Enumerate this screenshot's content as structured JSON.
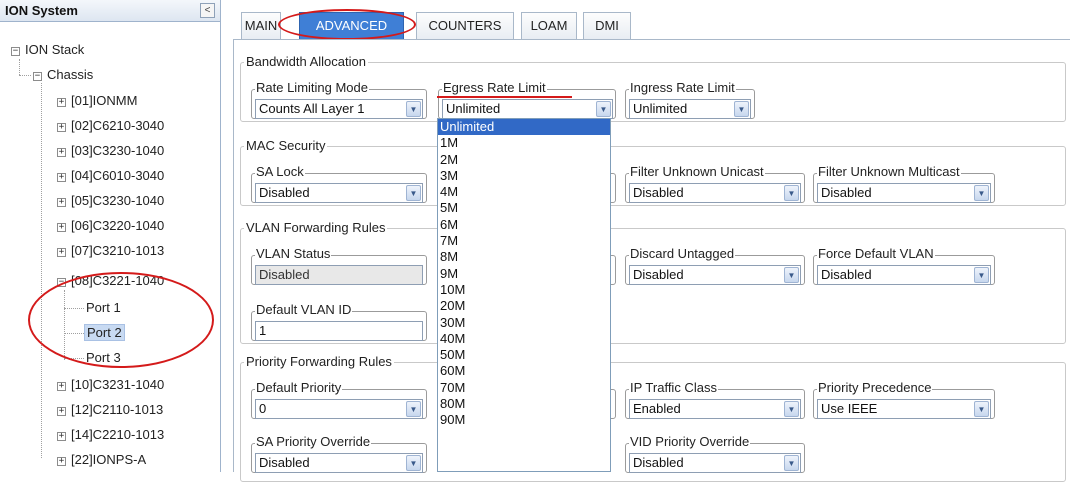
{
  "tree": {
    "title": "ION System",
    "collapse_glyph": "<",
    "root": "ION Stack",
    "chassis": "Chassis",
    "modules": [
      "[01]IONMM",
      "[02]C6210-3040",
      "[03]C3230-1040",
      "[04]C6010-3040",
      "[05]C3230-1040",
      "[06]C3220-1040",
      "[07]C3210-1013",
      "[08]C3221-1040"
    ],
    "ports": [
      "Port 1",
      "Port 2",
      "Port 3"
    ],
    "modules_after": [
      "[10]C3231-1040",
      "[12]C2110-1013",
      "[14]C2210-1013",
      "[22]IONPS-A"
    ],
    "selected_port": "Port 2"
  },
  "tabs": [
    "MAIN",
    "ADVANCED",
    "COUNTERS",
    "LOAM",
    "DMI"
  ],
  "active_tab": "ADVANCED",
  "bandwidth": {
    "title": "Bandwidth Allocation",
    "rate_mode_label": "Rate Limiting Mode",
    "rate_mode_value": "Counts All Layer 1",
    "egress_label": "Egress Rate Limit",
    "egress_value": "Unlimited",
    "ingress_label": "Ingress Rate Limit",
    "ingress_value": "Unlimited"
  },
  "mac": {
    "title": "MAC Security",
    "sa_lock_label": "SA Lock",
    "sa_lock_value": "Disabled",
    "unknown_unicast_label": "Filter Unknown Unicast",
    "unknown_unicast_value": "Disabled",
    "unknown_multicast_label": "Filter Unknown Multicast",
    "unknown_multicast_value": "Disabled"
  },
  "vlan": {
    "title": "VLAN Forwarding Rules",
    "status_label": "VLAN Status",
    "status_value": "Disabled",
    "discard_untagged_label": "Discard Untagged",
    "discard_untagged_value": "Disabled",
    "force_default_label": "Force Default VLAN",
    "force_default_value": "Disabled",
    "default_id_label": "Default VLAN ID",
    "default_id_value": "1"
  },
  "priority": {
    "title": "Priority Forwarding Rules",
    "default_priority_label": "Default Priority",
    "default_priority_value": "0",
    "ip_traffic_label": "IP Traffic Class",
    "ip_traffic_value": "Enabled",
    "precedence_label": "Priority Precedence",
    "precedence_value": "Use IEEE",
    "sa_override_label": "SA Priority Override",
    "sa_override_value": "Disabled",
    "vid_override_label": "VID Priority Override",
    "vid_override_value": "Disabled"
  },
  "egress_options": [
    "Unlimited",
    "1M",
    "2M",
    "3M",
    "4M",
    "5M",
    "6M",
    "7M",
    "8M",
    "9M",
    "10M",
    "20M",
    "30M",
    "40M",
    "50M",
    "60M",
    "70M",
    "80M",
    "90M"
  ],
  "egress_selected": "Unlimited",
  "colors": {
    "tab_active": "#3f7fd6",
    "selection": "#3169c6",
    "annotation": "#d41a1a"
  }
}
